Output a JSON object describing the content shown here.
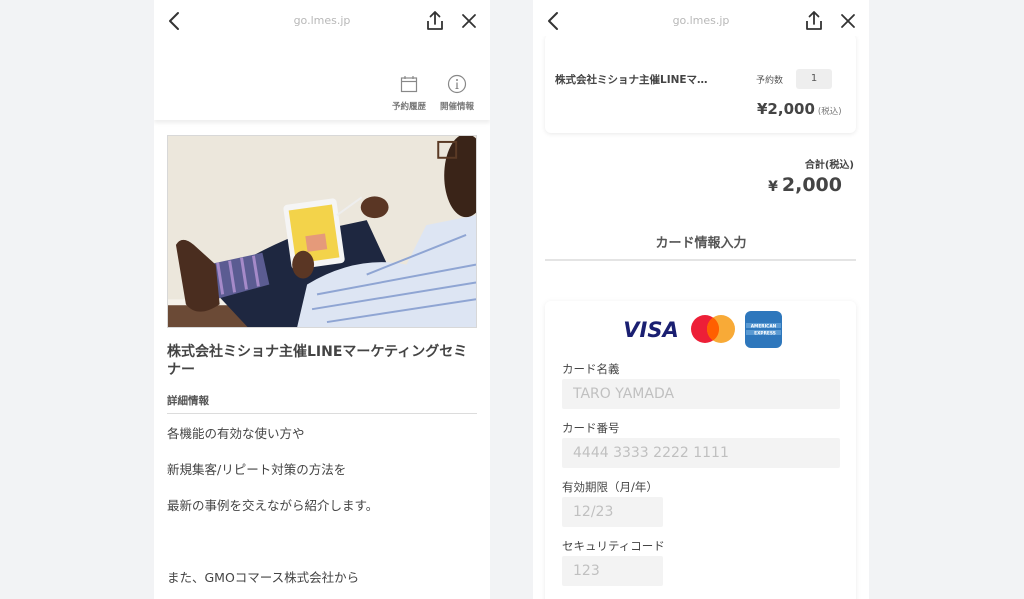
{
  "browser": {
    "url": "go.lmes.jp"
  },
  "left_page": {
    "nav": {
      "history_label": "予約履歴",
      "info_label": "開催情報"
    },
    "event": {
      "title": "株式会社ミショナ主催LINEマーケティングセミナー",
      "detail_heading": "詳細情報",
      "description_lines": [
        "各機能の有効な使い方や",
        "新規集客/リピート対策の方法を",
        "最新の事例を交えながら紹介します。",
        "また、GMOコマース株式会社から"
      ]
    }
  },
  "right_page": {
    "order": {
      "item_name": "株式会社ミショナ主催LINEマ…",
      "quantity_label": "予約数",
      "quantity": "1",
      "price": "¥2,000",
      "tax_note": "(税込)"
    },
    "total": {
      "label": "合計(税込)",
      "currency": "¥",
      "amount": "2,000"
    },
    "card": {
      "section_title": "カード情報入力",
      "brands": [
        "VISA",
        "Mastercard",
        "American Express"
      ],
      "amex_line1": "AMERICAN",
      "amex_line2": "EXPRESS",
      "visa_text": "VISA",
      "fields": {
        "holder": {
          "label": "カード名義",
          "placeholder": "TARO YAMADA"
        },
        "number": {
          "label": "カード番号",
          "placeholder": "4444 3333 2222 1111"
        },
        "expiry": {
          "label": "有効期限（月/年）",
          "placeholder": "12/23"
        },
        "cvc": {
          "label": "セキュリティコード",
          "placeholder": "123"
        }
      }
    }
  },
  "colors": {
    "visa_blue": "#1a1f71",
    "mc_red": "#eb001b",
    "mc_orange": "#f79e1b",
    "amex_blue": "#2e77bc"
  }
}
